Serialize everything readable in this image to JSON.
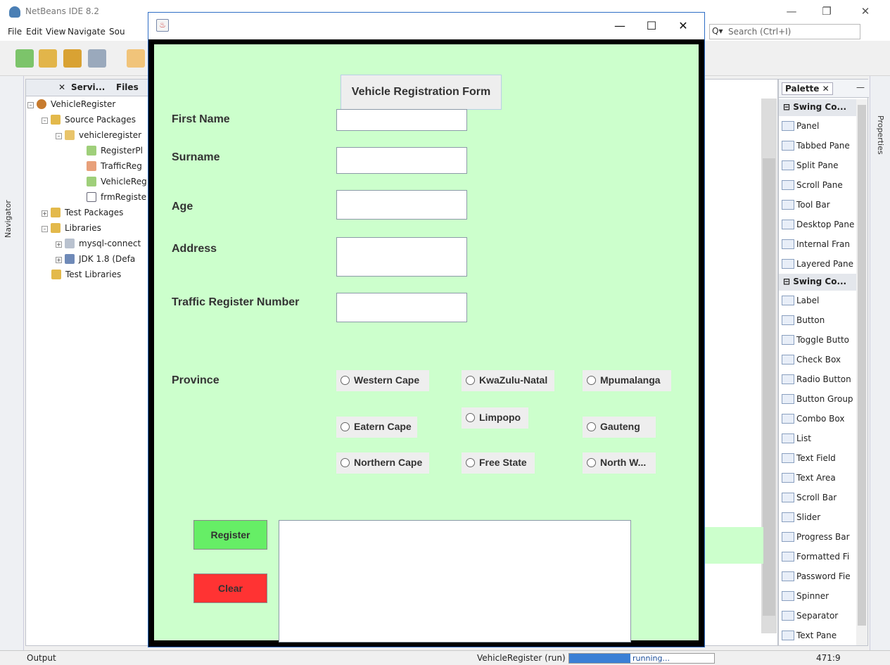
{
  "ide": {
    "title": "NetBeans IDE 8.2",
    "menu": [
      "File",
      "Edit",
      "View",
      "Navigate",
      "Sou"
    ],
    "search_placeholder": "Search (Ctrl+I)",
    "navigator_label": "Navigator",
    "properties_label": "Properties",
    "projects_tabs": [
      "Servi...",
      "Files"
    ],
    "tree": [
      {
        "label": "VehicleRegister",
        "depth": 0
      },
      {
        "label": "Source Packages",
        "depth": 1
      },
      {
        "label": "vehicleregister",
        "depth": 2
      },
      {
        "label": "RegisterPl",
        "depth": 3
      },
      {
        "label": "TrafficReg",
        "depth": 3
      },
      {
        "label": "VehicleReg",
        "depth": 3
      },
      {
        "label": "frmRegiste",
        "depth": 3
      },
      {
        "label": "Test Packages",
        "depth": 1
      },
      {
        "label": "Libraries",
        "depth": 1
      },
      {
        "label": "mysql-connect",
        "depth": 2
      },
      {
        "label": "JDK 1.8 (Defa",
        "depth": 2
      },
      {
        "label": "Test Libraries",
        "depth": 1
      }
    ],
    "palette_title": "Palette",
    "palette": [
      {
        "kind": "cat",
        "label": "Swing Co..."
      },
      {
        "kind": "item",
        "label": "Panel"
      },
      {
        "kind": "item",
        "label": "Tabbed Pane"
      },
      {
        "kind": "item",
        "label": "Split Pane"
      },
      {
        "kind": "item",
        "label": "Scroll Pane"
      },
      {
        "kind": "item",
        "label": "Tool Bar"
      },
      {
        "kind": "item",
        "label": "Desktop Pane"
      },
      {
        "kind": "item",
        "label": "Internal Fran"
      },
      {
        "kind": "item",
        "label": "Layered Pane"
      },
      {
        "kind": "cat",
        "label": "Swing Co..."
      },
      {
        "kind": "item",
        "label": "Label"
      },
      {
        "kind": "item",
        "label": "Button"
      },
      {
        "kind": "item",
        "label": "Toggle Butto"
      },
      {
        "kind": "item",
        "label": "Check Box"
      },
      {
        "kind": "item",
        "label": "Radio Button"
      },
      {
        "kind": "item",
        "label": "Button Group"
      },
      {
        "kind": "item",
        "label": "Combo Box"
      },
      {
        "kind": "item",
        "label": "List"
      },
      {
        "kind": "item",
        "label": "Text Field"
      },
      {
        "kind": "item",
        "label": "Text Area"
      },
      {
        "kind": "item",
        "label": "Scroll Bar"
      },
      {
        "kind": "item",
        "label": "Slider"
      },
      {
        "kind": "item",
        "label": "Progress Bar"
      },
      {
        "kind": "item",
        "label": "Formatted Fi"
      },
      {
        "kind": "item",
        "label": "Password Fie"
      },
      {
        "kind": "item",
        "label": "Spinner"
      },
      {
        "kind": "item",
        "label": "Separator"
      },
      {
        "kind": "item",
        "label": "Text Pane"
      }
    ],
    "status": {
      "output_label": "Output",
      "run_label": "VehicleRegister (run)",
      "progress_text": "running...",
      "progress_fraction": 0.42,
      "cursor_pos": "471:9"
    }
  },
  "app": {
    "form_title": "Vehicle Registration Form",
    "labels": {
      "first_name": "First Name",
      "surname": "Surname",
      "age": "Age",
      "address": "Address",
      "traffic_number": "Traffic Register Number",
      "province": "Province"
    },
    "provinces": [
      "Western Cape",
      "KwaZulu-Natal",
      "Mpumalanga",
      "Eatern Cape",
      "Limpopo",
      "Gauteng",
      "Northern Cape",
      "Free State",
      "North W..."
    ],
    "buttons": {
      "register": "Register",
      "clear": "Clear"
    },
    "colors": {
      "background": "#ccffcc",
      "register": "#66ee66",
      "clear": "#ff3333"
    }
  }
}
